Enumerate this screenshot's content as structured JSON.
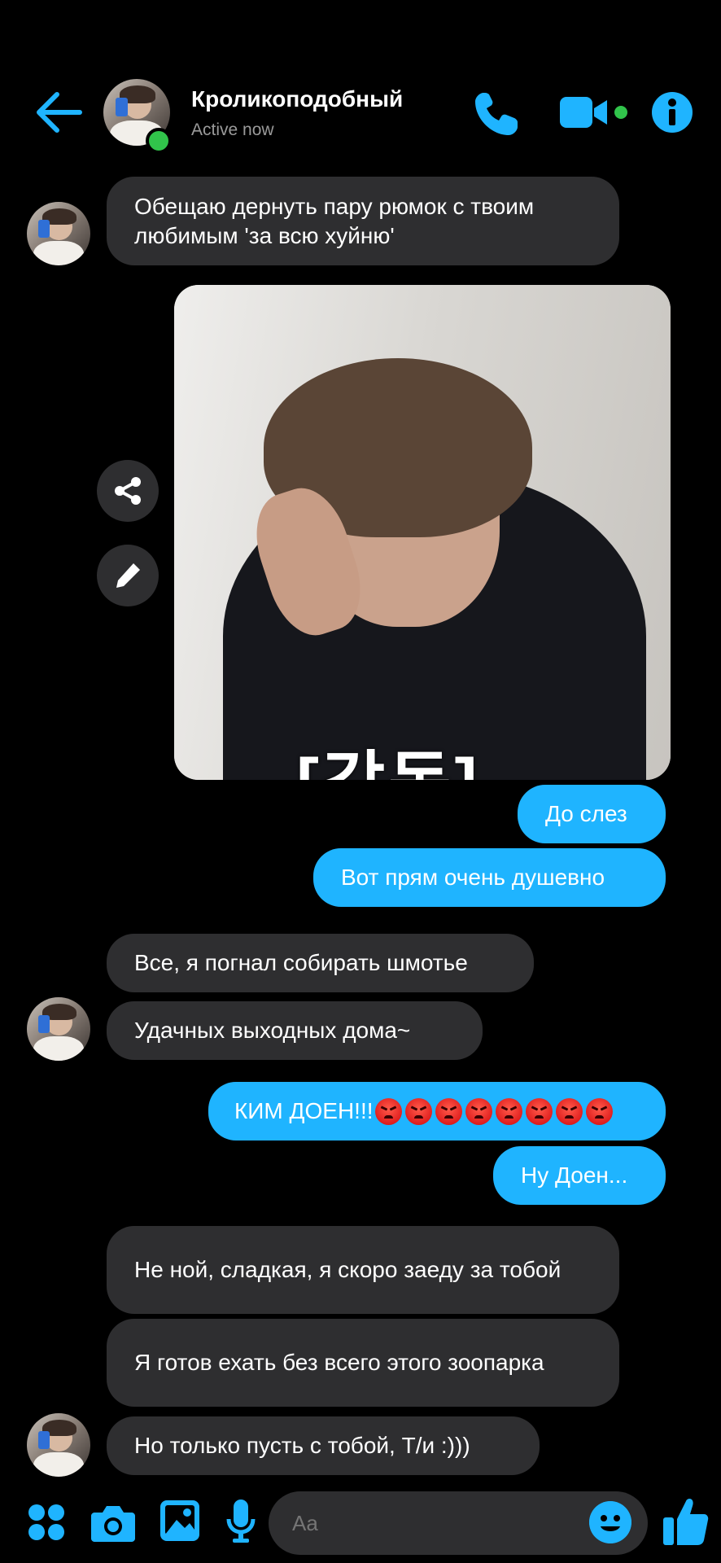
{
  "header": {
    "contact_name": "Кроликоподобный",
    "status": "Active now",
    "accent_color": "#1fb4ff",
    "icons": [
      "back-arrow-icon",
      "phone-icon",
      "video-camera-icon",
      "info-icon"
    ]
  },
  "messages": {
    "m1": "Обещаю дернуть пару рюмок с твоим любимым 'за всю хуйню'",
    "image_caption": "[감동]",
    "m2": "До слез",
    "m3": "Вот прям очень душевно",
    "m4": "Все, я погнал собирать шмотье",
    "m5": "Удачных выходных дома~",
    "m6": "КИМ ДОЕН!!!",
    "m6_emoji_count": 8,
    "m7": "Ну Доен...",
    "m8": "Не ной, сладкая, я скоро заеду за тобой",
    "m9": "Я готов ехать без всего этого зоопарка",
    "m10": "Но только пусть с тобой, Т/и :)))"
  },
  "composer": {
    "placeholder": "Aa",
    "icons": [
      "apps-icon",
      "camera-icon",
      "gallery-icon",
      "microphone-icon",
      "emoji-icon",
      "thumbs-up-icon"
    ]
  }
}
